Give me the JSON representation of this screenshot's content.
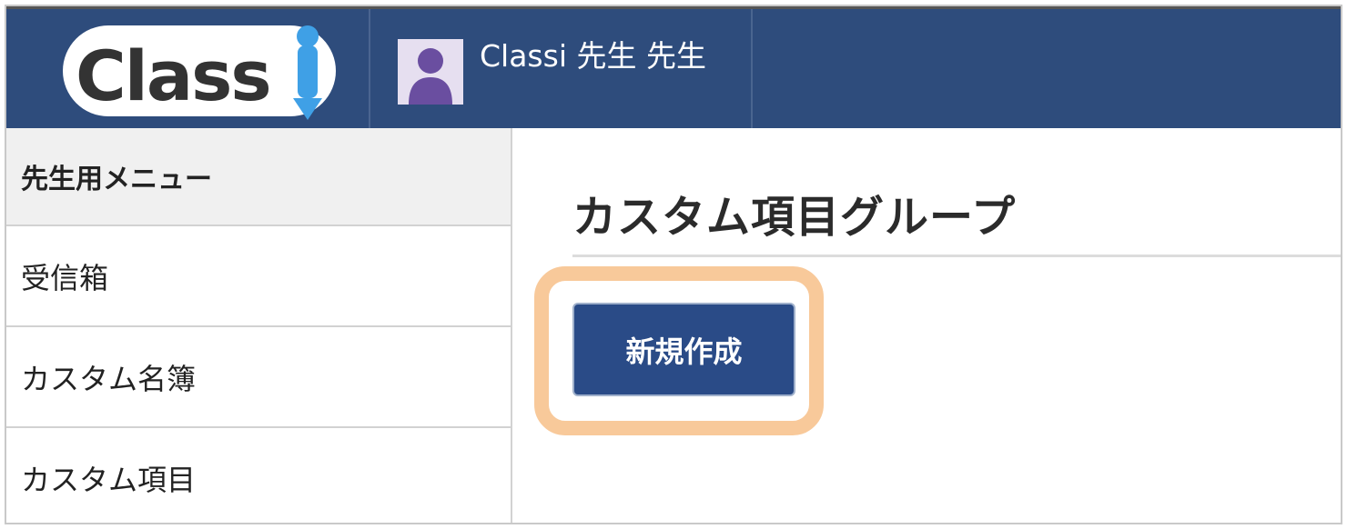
{
  "header": {
    "logo_text": "Classi",
    "user_name": "Classi 先生 先生"
  },
  "sidebar": {
    "heading": "先生用メニュー",
    "items": [
      {
        "label": "受信箱"
      },
      {
        "label": "カスタム名簿"
      },
      {
        "label": "カスタム項目"
      }
    ]
  },
  "main": {
    "title": "カスタム項目グループ",
    "new_button_label": "新規作成"
  },
  "colors": {
    "header_bg": "#2e4c7c",
    "button_bg": "#2a4b87",
    "highlight": "#f8c99a",
    "logo_accent": "#3fa0e6"
  },
  "icons": {
    "avatar": "user-silhouette-icon"
  }
}
